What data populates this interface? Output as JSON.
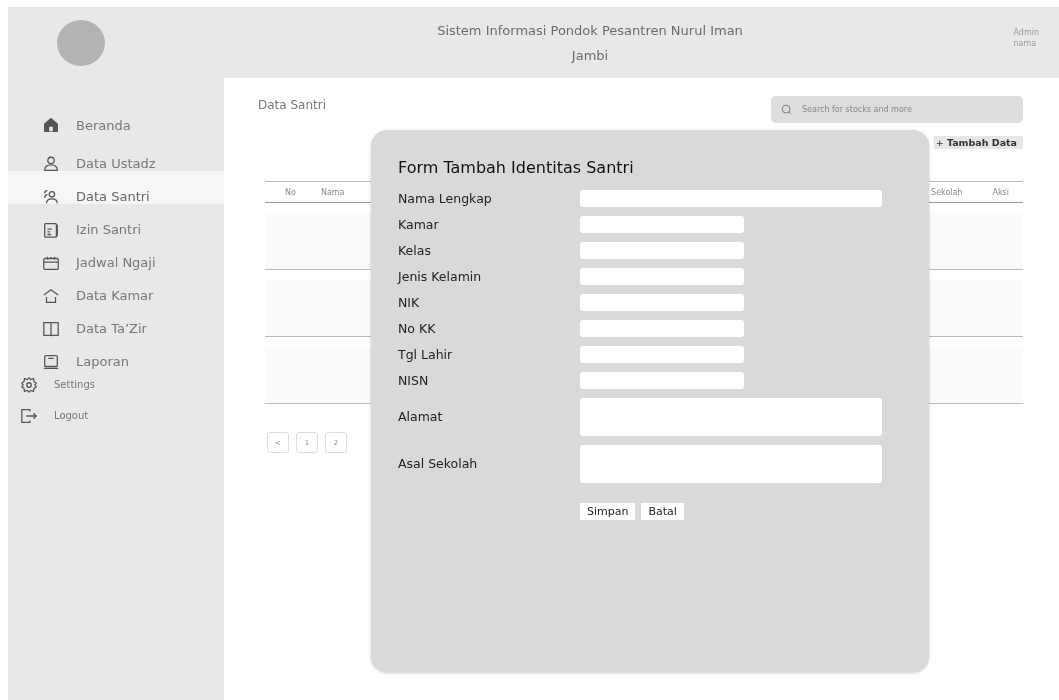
{
  "header": {
    "title": "Sistem Informasi Pondok Pesantren Nurul Iman Jambi",
    "user_role": "Admin",
    "user_name": "nama"
  },
  "sidebar": {
    "items": [
      {
        "label": "Beranda",
        "kind": "main",
        "selected": false
      },
      {
        "label": "Data Ustadz",
        "kind": "main",
        "selected": false
      },
      {
        "label": "Data Santri",
        "kind": "main",
        "selected": true
      },
      {
        "label": "Izin Santri",
        "kind": "main",
        "selected": false
      },
      {
        "label": "Jadwal Ngaji",
        "kind": "main",
        "selected": false
      },
      {
        "label": "Data Kamar",
        "kind": "main",
        "selected": false
      },
      {
        "label": "Data Ta’Zir",
        "kind": "main",
        "selected": false
      },
      {
        "label": "Laporan",
        "kind": "main",
        "selected": false
      },
      {
        "label": "Settings",
        "kind": "minor",
        "selected": false
      },
      {
        "label": "Logout",
        "kind": "minor",
        "selected": false
      }
    ]
  },
  "page_title": "Data Santri",
  "search": {
    "placeholder": "Search for stocks and more"
  },
  "add_button": {
    "icon": "+",
    "label": "Tambah Data"
  },
  "table": {
    "columns_left": [
      "No",
      "Nama"
    ],
    "columns_right": [
      "Sekolah",
      "Aksi"
    ]
  },
  "pagination": {
    "prev": "<",
    "pages": [
      "1",
      "2"
    ]
  },
  "modal": {
    "title": "Form Tambah Identitas Santri",
    "fields": [
      {
        "label": "Nama Lengkap",
        "kind": "long"
      },
      {
        "label": "Kamar",
        "kind": "short"
      },
      {
        "label": "Kelas",
        "kind": "short"
      },
      {
        "label": "Jenis Kelamin",
        "kind": "short"
      },
      {
        "label": "NIK",
        "kind": "short"
      },
      {
        "label": "No KK",
        "kind": "short"
      },
      {
        "label": "Tgl Lahir",
        "kind": "short"
      },
      {
        "label": "NISN",
        "kind": "short"
      },
      {
        "label": "Alamat",
        "kind": "area"
      },
      {
        "label": "Asal Sekolah",
        "kind": "area"
      }
    ],
    "buttons": [
      "Simpan",
      "Batal"
    ]
  }
}
